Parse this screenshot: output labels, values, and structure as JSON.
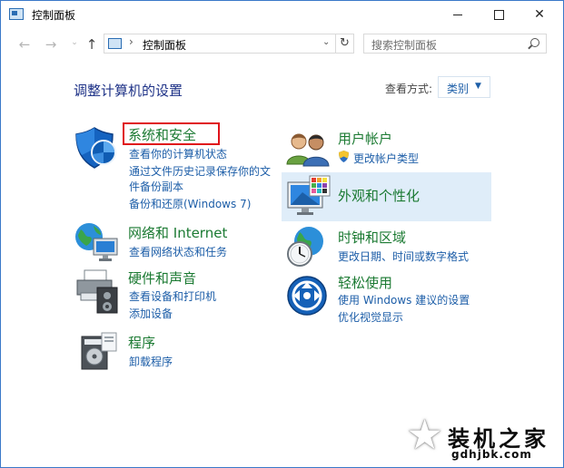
{
  "window": {
    "title": "控制面板",
    "controls": {
      "minimize": "minimize",
      "maximize": "maximize",
      "close": "✕"
    }
  },
  "navigation": {
    "back": "←",
    "forward": "→",
    "recent": "⌄",
    "up": "↑",
    "address_separator": "›",
    "address": "控制面板",
    "address_dropdown": "⌄",
    "refresh": "↻",
    "search_placeholder": "搜索控制面板"
  },
  "main": {
    "heading": "调整计算机的设置",
    "view_by_label": "查看方式:",
    "view_by_value": "类别",
    "view_by_arrow": "▼"
  },
  "categories_left": [
    {
      "title": "系统和安全",
      "links": [
        "查看你的计算机状态",
        "通过文件历史记录保存你的文",
        "件备份副本",
        "备份和还原(Windows 7)"
      ],
      "icon": "shield-icon"
    },
    {
      "title": "网络和 Internet",
      "links": [
        "查看网络状态和任务"
      ],
      "icon": "network-globe-icon"
    },
    {
      "title": "硬件和声音",
      "links": [
        "查看设备和打印机",
        "添加设备"
      ],
      "icon": "printer-speaker-icon"
    },
    {
      "title": "程序",
      "links": [
        "卸载程序"
      ],
      "icon": "programs-icon"
    }
  ],
  "categories_right": [
    {
      "title": "用户帐户",
      "links": [
        "更改帐户类型"
      ],
      "icon": "users-icon"
    },
    {
      "title": "外观和个性化",
      "links": [],
      "icon": "monitor-palette-icon"
    },
    {
      "title": "时钟和区域",
      "links": [
        "更改日期、时间或数字格式"
      ],
      "icon": "clock-globe-icon"
    },
    {
      "title": "轻松使用",
      "links": [
        "使用 Windows 建议的设置",
        "优化视觉显示"
      ],
      "icon": "ease-of-access-icon"
    }
  ],
  "watermark": {
    "title": "装机之家",
    "url": "gdhjbk.com"
  },
  "colors": {
    "category_title": "#1b7a32",
    "link": "#1d5ea8",
    "heading": "#1e3287",
    "highlight_box": "#e0131a",
    "hover_background": "#dfedf9"
  }
}
